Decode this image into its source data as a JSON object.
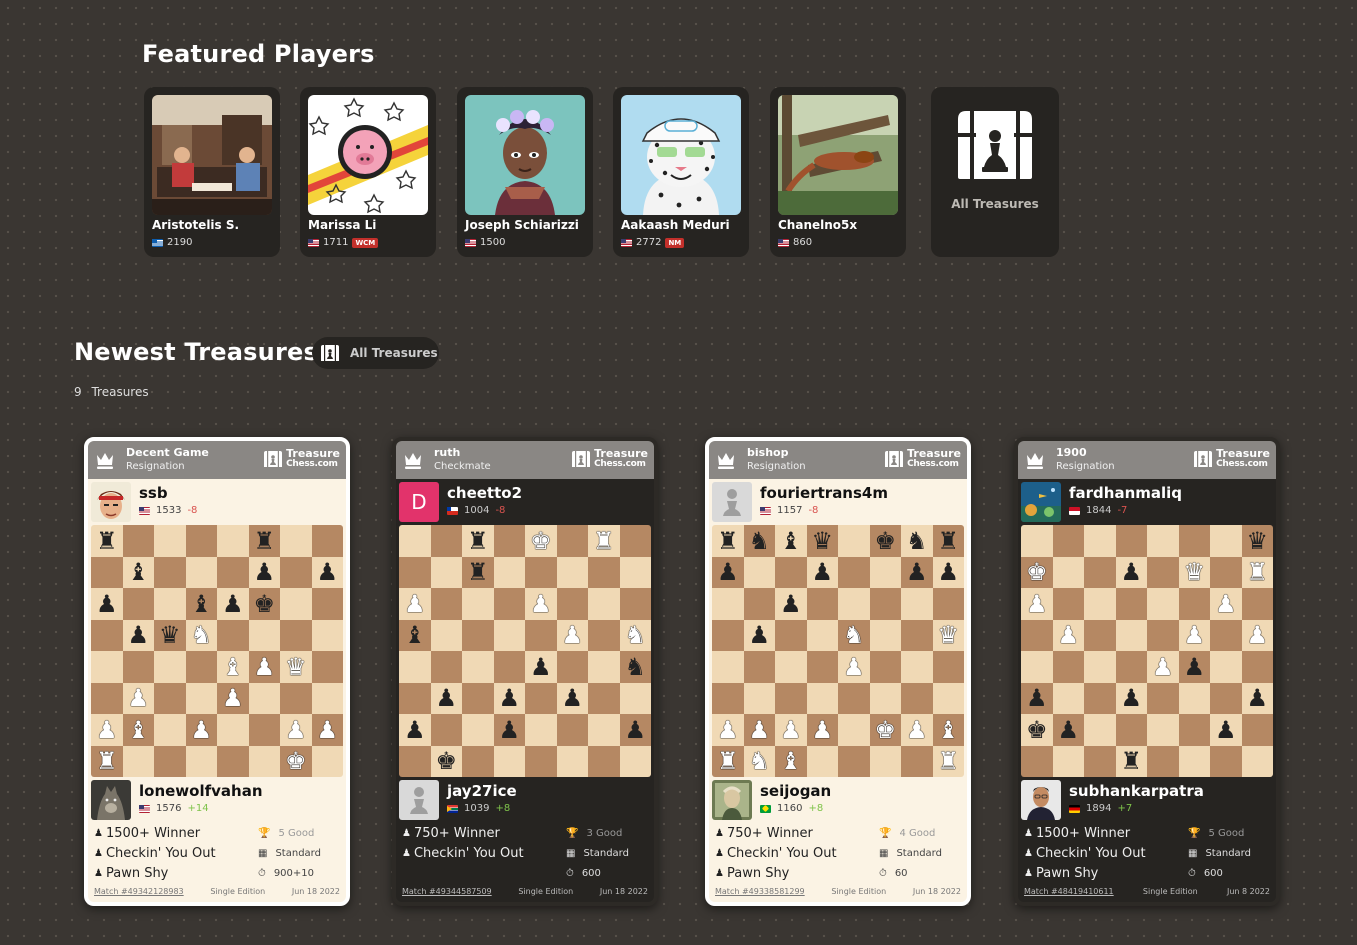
{
  "featured": {
    "title": "Featured Players",
    "players": [
      {
        "name": "Aristotelis S.",
        "rating": "2190",
        "badge": "",
        "flag": "gr"
      },
      {
        "name": "Marissa Li",
        "rating": "1711",
        "badge": "WCM",
        "flag": "us"
      },
      {
        "name": "Joseph Schiarizzi",
        "rating": "1500",
        "badge": "",
        "flag": "us"
      },
      {
        "name": "Aakaash Meduri",
        "rating": "2772",
        "badge": "NM",
        "flag": "us"
      },
      {
        "name": "Chanelno5x",
        "rating": "860",
        "badge": "",
        "flag": "us"
      }
    ],
    "all_label": "All Treasures"
  },
  "newest": {
    "title": "Newest Treasures",
    "button_label": "All Treasures",
    "count": "9",
    "count_label": "Treasures"
  },
  "brand": {
    "line1": "Treasure",
    "line2": "Chess.com"
  },
  "cards": [
    {
      "theme": "light",
      "head_title": "Decent Game",
      "head_sub": "Resignation",
      "top": {
        "name": "ssb",
        "rating": "1533",
        "delta": "-8",
        "flag": "us",
        "avatar": "fighter"
      },
      "bottom": {
        "name": "lonewolfvahan",
        "rating": "1576",
        "delta": "+14",
        "flag": "us",
        "avatar": "wolf"
      },
      "board": [
        "r....r..",
        ".b...p.p",
        "p..bpk..",
        ".pqN....",
        "....BPQ.",
        ".P..P...",
        "PB.P..PP",
        "R.....K."
      ],
      "achievements": [
        "1500+ Winner",
        "Checkin' You Out",
        "Pawn Shy"
      ],
      "meta": [
        {
          "icon": "trophy-icon",
          "glyph": "🏆",
          "text": "5 Good",
          "dim": true
        },
        {
          "icon": "board-icon",
          "glyph": "▦",
          "text": "Standard",
          "dim": false
        },
        {
          "icon": "timer-icon",
          "glyph": "⏱",
          "text": "900+10",
          "dim": false
        }
      ],
      "match": "Match #49342128983",
      "edition": "Single Edition",
      "date": "Jun 18 2022"
    },
    {
      "theme": "dark",
      "head_title": "ruth",
      "head_sub": "Checkmate",
      "top": {
        "name": "cheetto2",
        "rating": "1004",
        "delta": "-8",
        "flag": "cl",
        "avatar": "letter-d"
      },
      "bottom": {
        "name": "jay27ice",
        "rating": "1039",
        "delta": "+8",
        "flag": "za",
        "avatar": "pawn"
      },
      "board": [
        "..r.K.R.",
        "..r.....",
        "P...P...",
        "b....P.N",
        "....p..n",
        ".p.p.p..",
        "p..p...p",
        ".k......"
      ],
      "achievements": [
        "750+ Winner",
        "Checkin' You Out"
      ],
      "meta": [
        {
          "icon": "trophy-icon",
          "glyph": "🏆",
          "text": "3 Good",
          "dim": true
        },
        {
          "icon": "board-icon",
          "glyph": "▦",
          "text": "Standard",
          "dim": false
        },
        {
          "icon": "timer-icon",
          "glyph": "⏱",
          "text": "600",
          "dim": false
        }
      ],
      "match": "Match #49344587509",
      "edition": "Single Edition",
      "date": "Jun 18 2022"
    },
    {
      "theme": "light",
      "head_title": "bishop",
      "head_sub": "Resignation",
      "top": {
        "name": "fouriertrans4m",
        "rating": "1157",
        "delta": "-8",
        "flag": "us",
        "avatar": "pawn"
      },
      "bottom": {
        "name": "seijogan",
        "rating": "1160",
        "delta": "+8",
        "flag": "br",
        "avatar": "portrait"
      },
      "board": [
        "rnbq.knr",
        "p..p..pp",
        "..p.....",
        ".p..N..Q",
        "....P...",
        "........",
        "PPPP.KPB",
        "RNB....R"
      ],
      "achievements": [
        "750+ Winner",
        "Checkin' You Out",
        "Pawn Shy"
      ],
      "meta": [
        {
          "icon": "trophy-icon",
          "glyph": "🏆",
          "text": "4 Good",
          "dim": true
        },
        {
          "icon": "board-icon",
          "glyph": "▦",
          "text": "Standard",
          "dim": false
        },
        {
          "icon": "timer-icon",
          "glyph": "⏱",
          "text": "60",
          "dim": false
        }
      ],
      "match": "Match #49338581299",
      "edition": "Single Edition",
      "date": "Jun 18 2022"
    },
    {
      "theme": "dark",
      "head_title": "1900",
      "head_sub": "Resignation",
      "top": {
        "name": "fardhanmaliq",
        "rating": "1844",
        "delta": "-7",
        "flag": "id",
        "avatar": "reef"
      },
      "bottom": {
        "name": "subhankarpatra",
        "rating": "1894",
        "delta": "+7",
        "flag": "de",
        "avatar": "man"
      },
      "board": [
        ".......q",
        "K..p.Q.R",
        "P.....P.",
        ".P...P.P",
        "....Pp..",
        "p..p...p",
        "kp....p.",
        "...r...."
      ],
      "achievements": [
        "1500+ Winner",
        "Checkin' You Out",
        "Pawn Shy"
      ],
      "meta": [
        {
          "icon": "trophy-icon",
          "glyph": "🏆",
          "text": "5 Good",
          "dim": true
        },
        {
          "icon": "board-icon",
          "glyph": "▦",
          "text": "Standard",
          "dim": false
        },
        {
          "icon": "timer-icon",
          "glyph": "⏱",
          "text": "600",
          "dim": false
        }
      ],
      "match": "Match #48419410611",
      "edition": "Single Edition",
      "date": "Jun 8 2022"
    }
  ]
}
